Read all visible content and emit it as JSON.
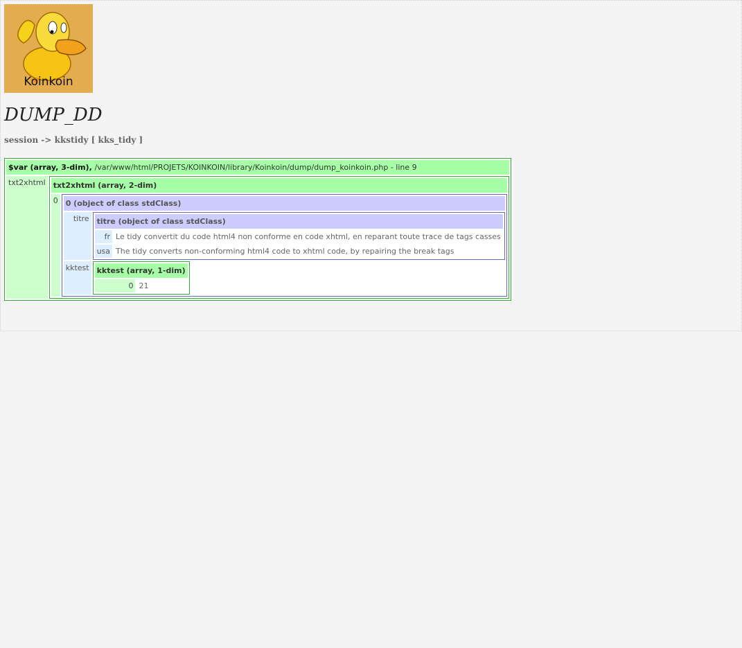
{
  "logo": {
    "text": "Koinkoin",
    "icon": "duck-mascot-icon"
  },
  "title": "DUMP_DD",
  "breadcrumb": {
    "context": "session",
    "arrow": "->",
    "name": "kkstidy",
    "key": "[ kks_tidy ]"
  },
  "dump": {
    "header_var": "$var (array, 3-dim),",
    "header_path": "/var/www/html/PROJETS/KOINKOIN/library/Koinkoin/dump/dump_koinkoin.php - line 9",
    "key": "txt2xhtml",
    "child": {
      "header": "txt2xhtml (array, 2-dim)",
      "key": "0",
      "child": {
        "header": "0 (object of class stdClass)",
        "titre_key": "titre",
        "titre": {
          "header": "titre (object of class stdClass)",
          "rows": [
            {
              "key": "fr",
              "value": "Le tidy convertit du code html4 non conforme en code xhtml, en reparant toute trace de tags casses"
            },
            {
              "key": "usa",
              "value": "The tidy converts non-conforming html4 code to xhtml code, by repairing the break tags"
            }
          ]
        },
        "kktest_key": "kktest",
        "kktest": {
          "header": "kktest (array, 1-dim)",
          "rows": [
            {
              "key": "0",
              "value": "21"
            }
          ]
        }
      }
    }
  },
  "colors": {
    "array_header": "#a6ffa6",
    "array_key": "#ccffcc",
    "object_header": "#ccccff",
    "object_key": "#ddeeff"
  }
}
